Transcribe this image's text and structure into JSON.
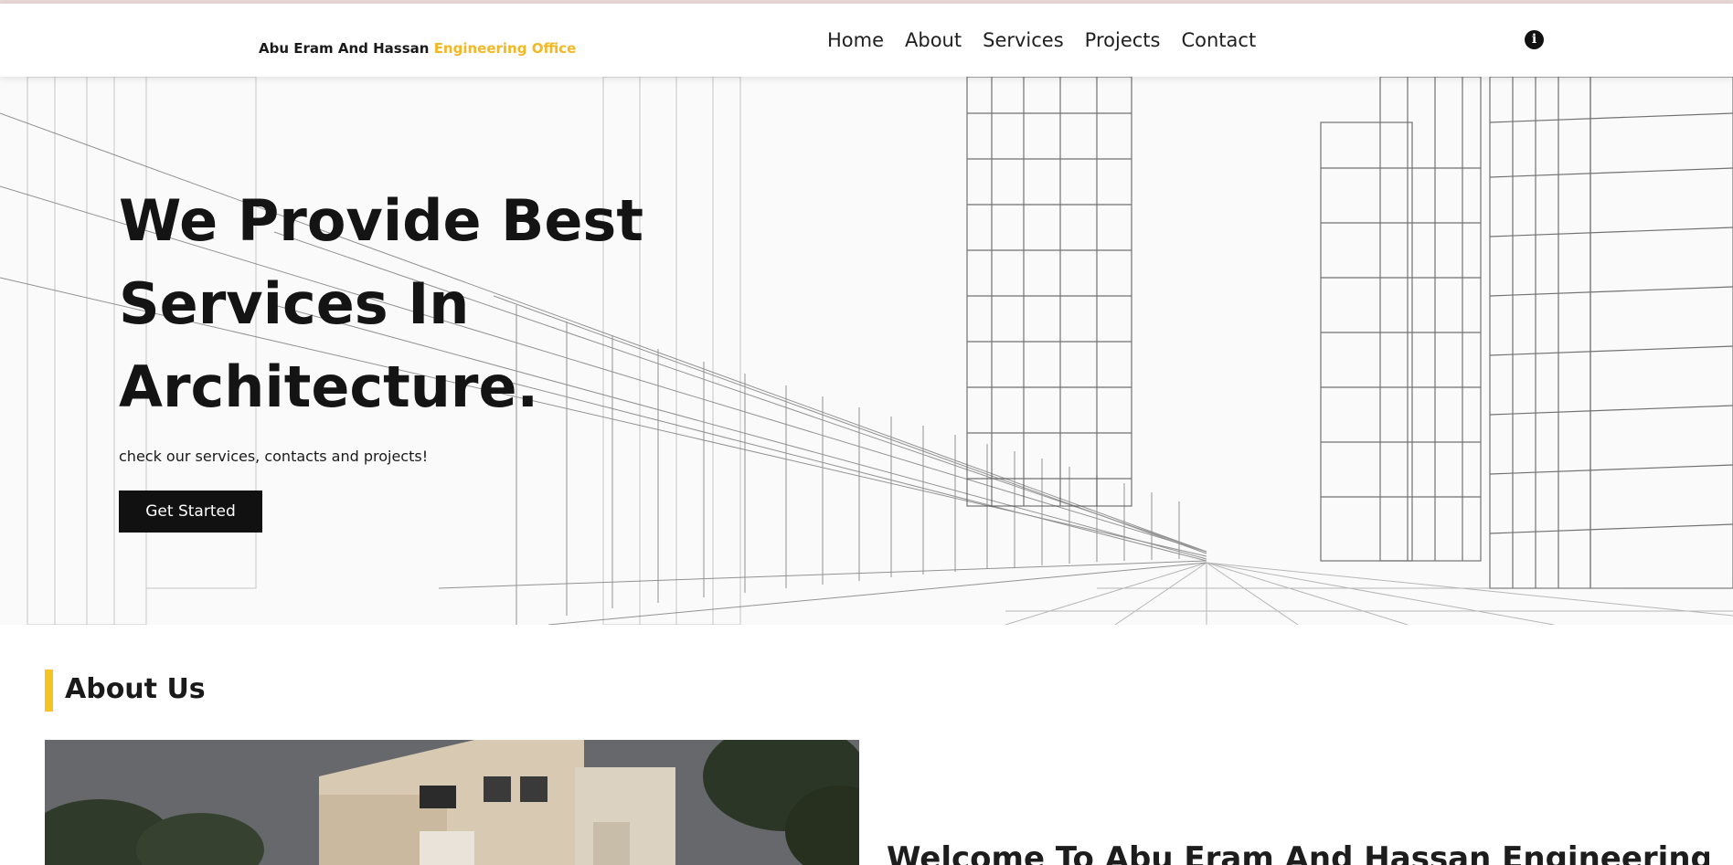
{
  "navbar": {
    "brand_main": "Abu Eram And Hassan",
    "brand_accent": "Engineering Office",
    "links": [
      "Home",
      "About",
      "Services",
      "Projects",
      "Contact"
    ],
    "info_icon": "info-circle-icon"
  },
  "hero": {
    "title": "We Provide Best Services In Architecture.",
    "subtitle": "check our services, contacts and projects!",
    "cta_label": "Get Started"
  },
  "about": {
    "section_title": "About Us",
    "heading": "Welcome To Abu Eram And Hassan Engineering"
  },
  "colors": {
    "accent": "#f2b824",
    "dark": "#111111"
  }
}
